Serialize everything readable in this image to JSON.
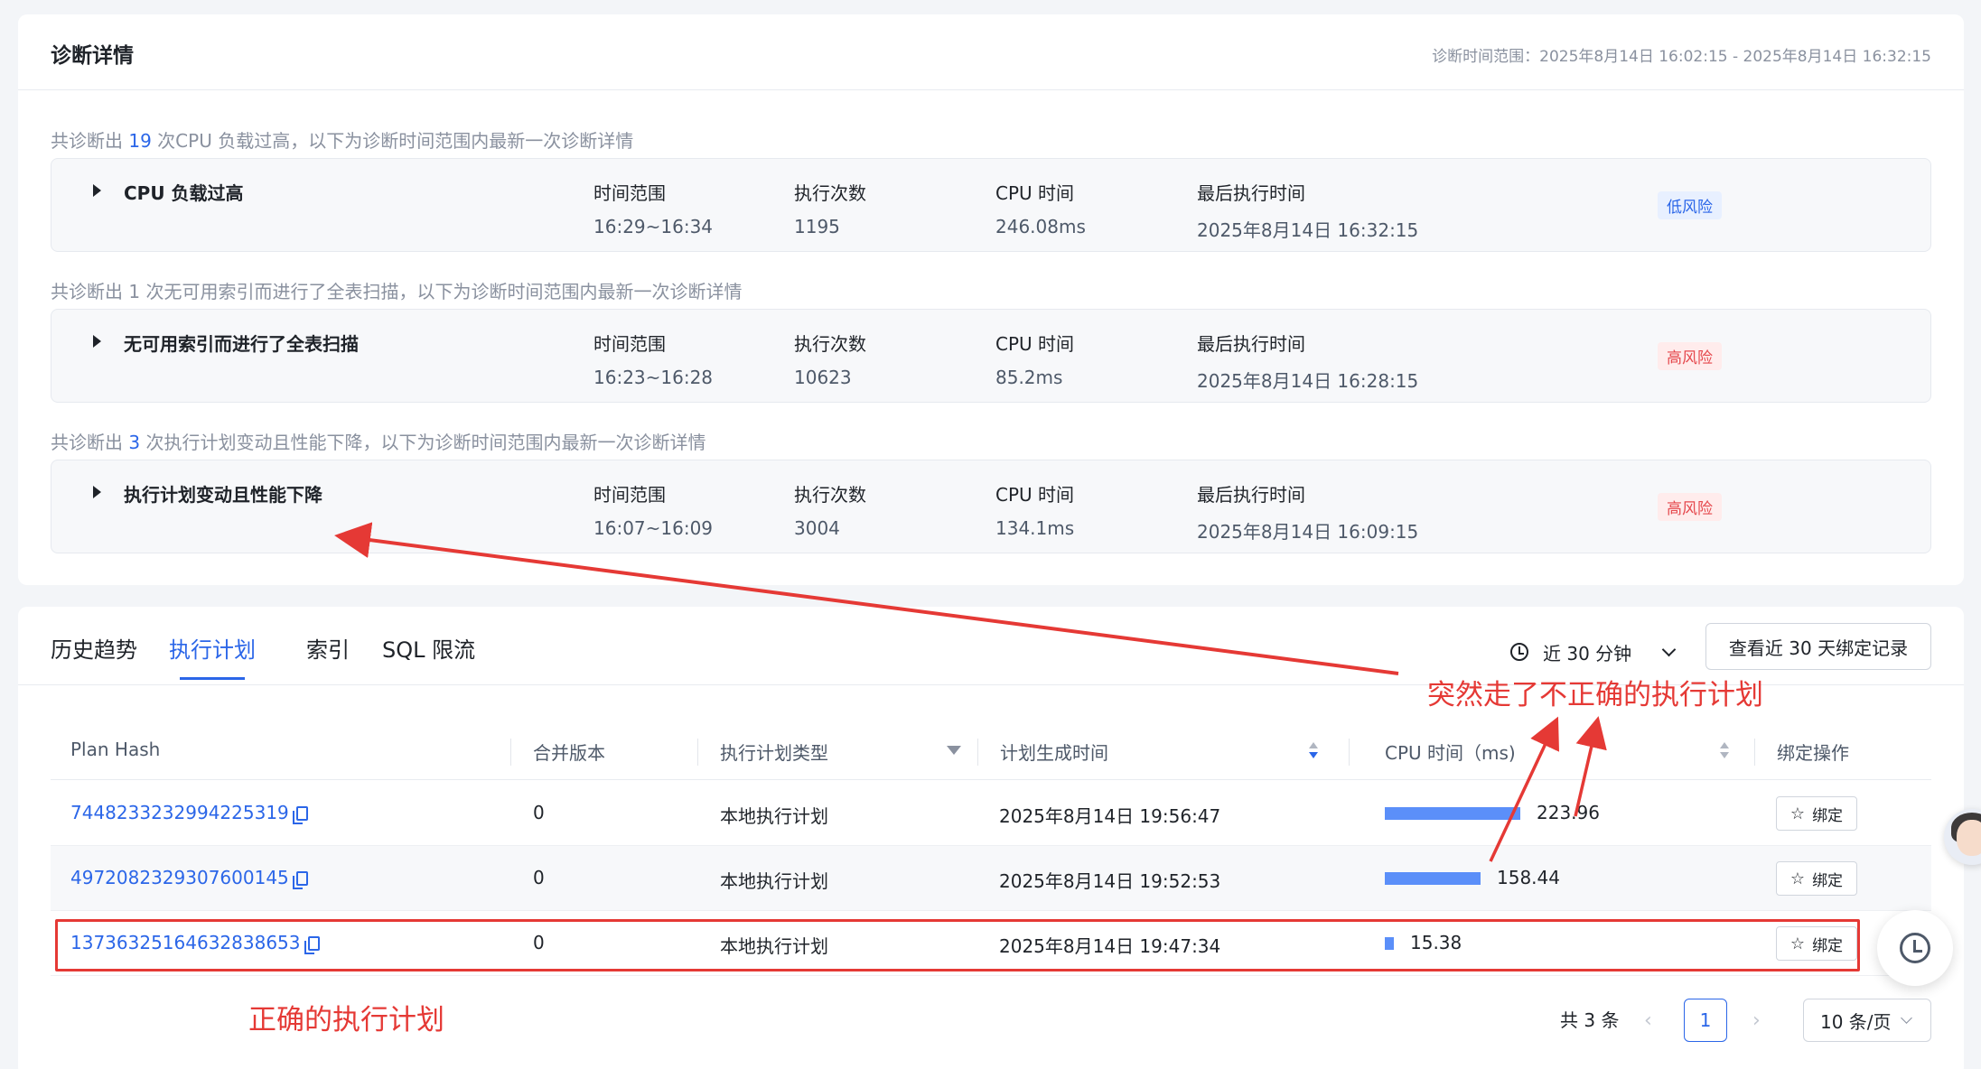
{
  "diagnosis": {
    "title": "诊断详情",
    "time_range_label": "诊断时间范围：2025年8月14日 16:02:15 - 2025年8月14日 16:32:15",
    "field_labels": {
      "time_range": "时间范围",
      "exec_count": "执行次数",
      "cpu_time": "CPU 时间",
      "last_exec": "最后执行时间"
    },
    "groups": [
      {
        "summary_prefix": "共诊断出",
        "count": "19",
        "summary_suffix": "次CPU 负载过高，以下为诊断时间范围内最新一次诊断详情",
        "rule": "CPU 负载过高",
        "time_range": "16:29~16:34",
        "exec_count": "1195",
        "cpu_time": "246.08ms",
        "last_exec": "2025年8月14日 16:32:15",
        "risk": "低风险",
        "risk_level": "low"
      },
      {
        "summary_prefix": "共诊断出",
        "count": "1",
        "summary_suffix": "次无可用索引而进行了全表扫描，以下为诊断时间范围内最新一次诊断详情",
        "rule": "无可用索引而进行了全表扫描",
        "time_range": "16:23~16:28",
        "exec_count": "10623",
        "cpu_time": "85.2ms",
        "last_exec": "2025年8月14日 16:28:15",
        "risk": "高风险",
        "risk_level": "high"
      },
      {
        "summary_prefix": "共诊断出",
        "count": "3",
        "summary_suffix": "次执行计划变动且性能下降，以下为诊断时间范围内最新一次诊断详情",
        "rule": "执行计划变动且性能下降",
        "time_range": "16:07~16:09",
        "exec_count": "3004",
        "cpu_time": "134.1ms",
        "last_exec": "2025年8月14日 16:09:15",
        "risk": "高风险",
        "risk_level": "high"
      }
    ]
  },
  "tabs": [
    {
      "label": "历史趋势",
      "active": false
    },
    {
      "label": "执行计划",
      "active": true
    },
    {
      "label": "索引",
      "active": false
    },
    {
      "label": "SQL 限流",
      "active": false
    }
  ],
  "toolbar": {
    "time_select": "近 30 分钟",
    "bind_history_button": "查看近 30 天绑定记录"
  },
  "table": {
    "columns": [
      "Plan Hash",
      "合并版本",
      "执行计划类型",
      "计划生成时间",
      "CPU 时间（ms)",
      "绑定操作"
    ],
    "cpu_max": 223.96,
    "rows": [
      {
        "plan_hash": "7448233232994225319",
        "version": "0",
        "type": "本地执行计划",
        "created": "2025年8月14日 19:56:47",
        "cpu": 223.96,
        "cpu_text": "223.96",
        "action": "绑定"
      },
      {
        "plan_hash": "4972082329307600145",
        "version": "0",
        "type": "本地执行计划",
        "created": "2025年8月14日 19:52:53",
        "cpu": 158.44,
        "cpu_text": "158.44",
        "action": "绑定"
      },
      {
        "plan_hash": "13736325164632838653",
        "version": "0",
        "type": "本地执行计划",
        "created": "2025年8月14日 19:47:34",
        "cpu": 15.38,
        "cpu_text": "15.38",
        "action": "绑定"
      }
    ]
  },
  "pagination": {
    "total": "共 3 条",
    "current_page": "1",
    "page_size": "10 条/页"
  },
  "annotations": {
    "wrong_plan": "突然走了不正确的执行计划",
    "correct_plan": "正确的执行计划",
    "color": "#e53935"
  },
  "colors": {
    "accent": "#2b66e8",
    "bar": "#5b8ff9",
    "risk_low": "#2b66e8",
    "risk_high": "#e5484d"
  }
}
